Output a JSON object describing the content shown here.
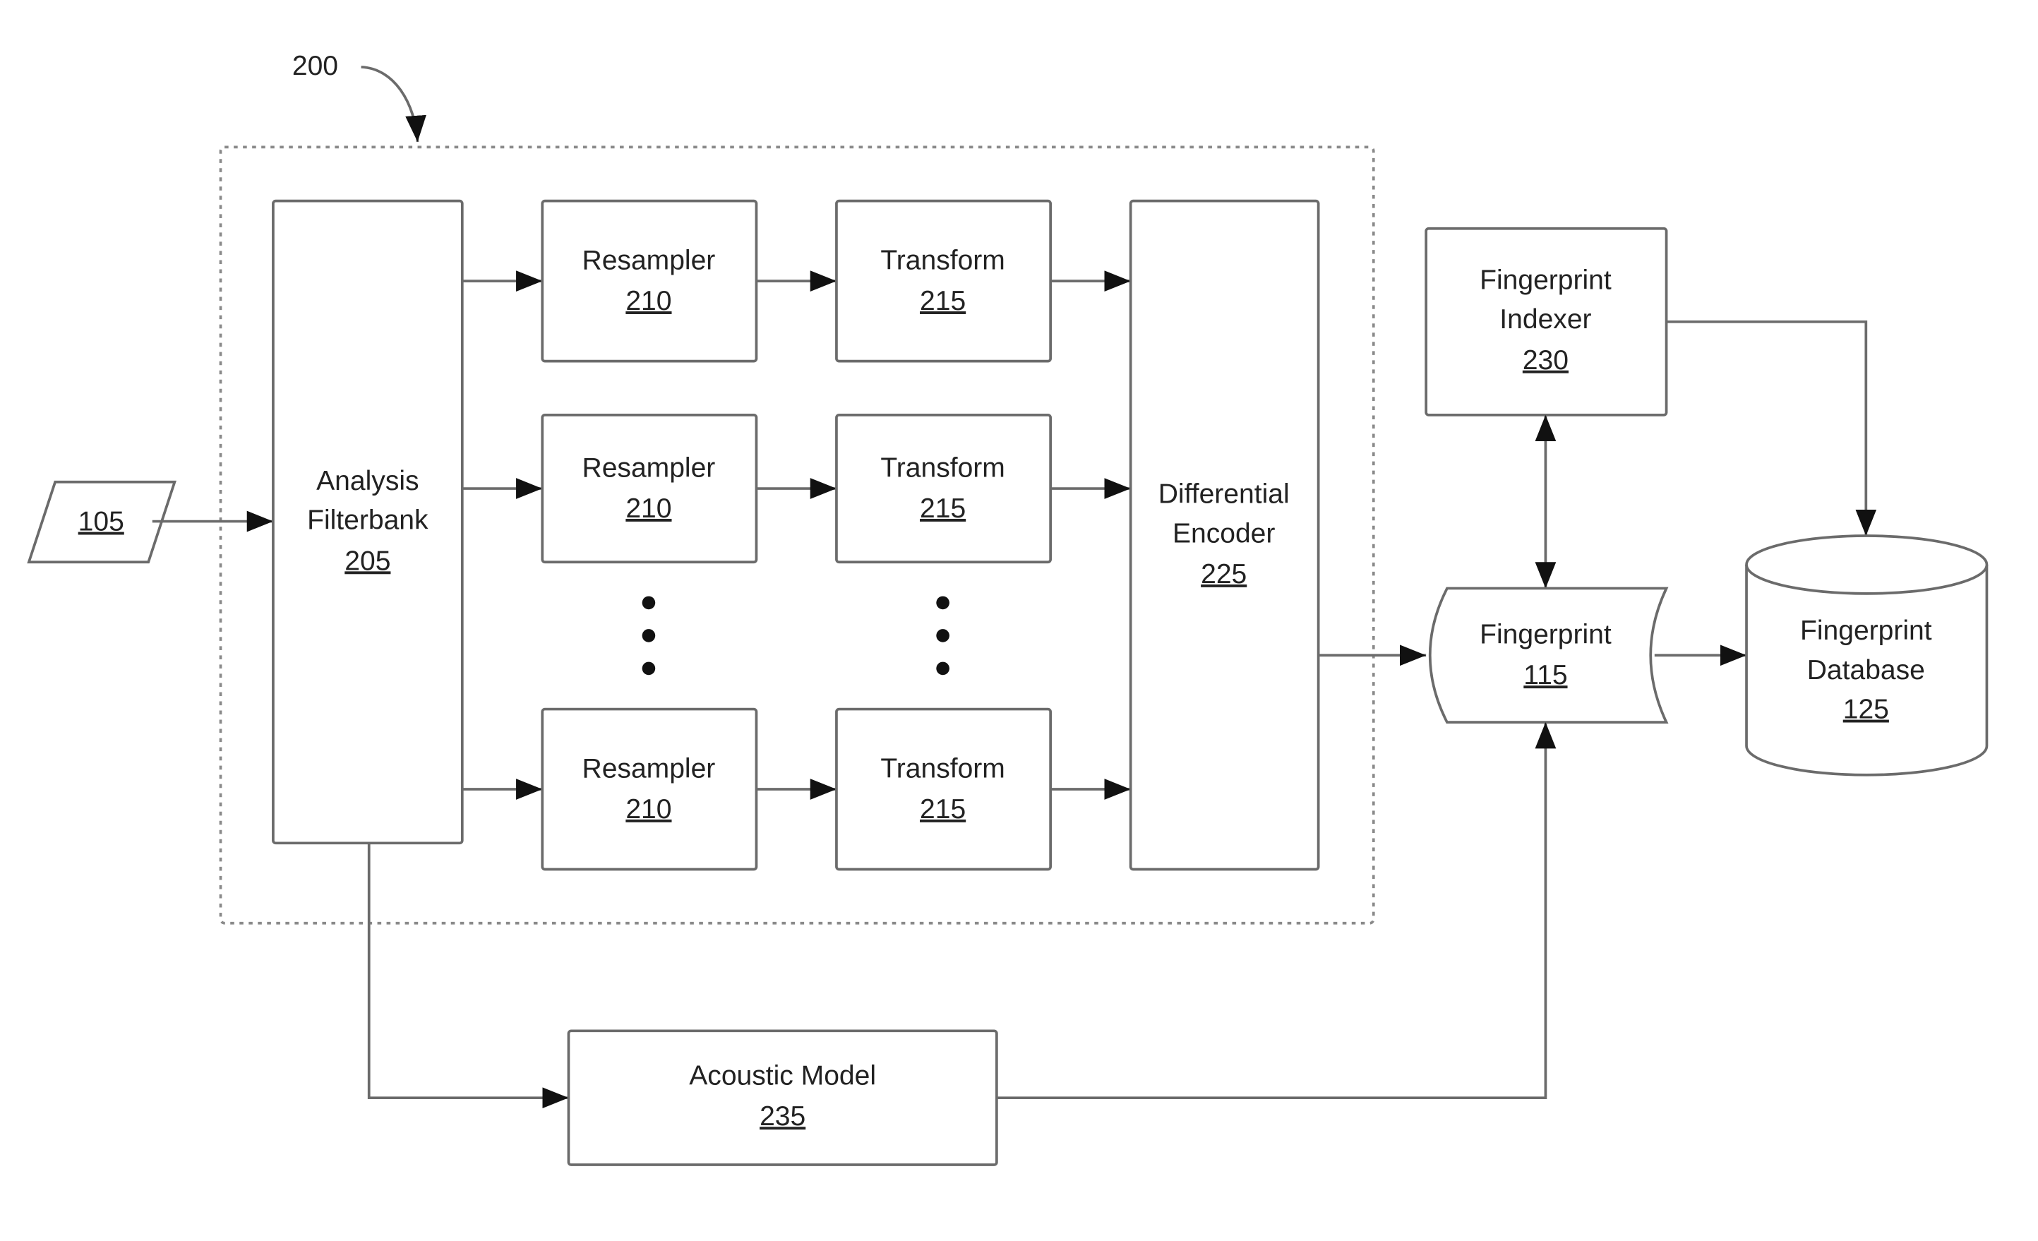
{
  "figure": {
    "reference_label": "200",
    "input": {
      "number": "105"
    },
    "analysis_filterbank": {
      "line1": "Analysis",
      "line2": "Filterbank",
      "number": "205"
    },
    "resamplers": [
      {
        "label": "Resampler",
        "number": "210"
      },
      {
        "label": "Resampler",
        "number": "210"
      },
      {
        "label": "Resampler",
        "number": "210"
      }
    ],
    "transforms": [
      {
        "label": "Transform",
        "number": "215"
      },
      {
        "label": "Transform",
        "number": "215"
      },
      {
        "label": "Transform",
        "number": "215"
      }
    ],
    "differential_encoder": {
      "line1": "Differential",
      "line2": "Encoder",
      "number": "225"
    },
    "fingerprint_indexer": {
      "line1": "Fingerprint",
      "line2": "Indexer",
      "number": "230"
    },
    "fingerprint": {
      "label": "Fingerprint",
      "number": "115"
    },
    "fingerprint_database": {
      "line1": "Fingerprint",
      "line2": "Database",
      "number": "125"
    },
    "acoustic_model": {
      "label": "Acoustic Model",
      "number": "235"
    }
  }
}
